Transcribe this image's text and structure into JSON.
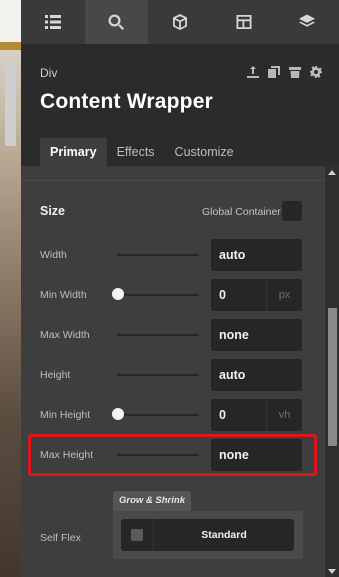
{
  "colors": {
    "highlight": "#e0141c",
    "panel_bg": "#343434",
    "header_bg": "#2b2b2b",
    "content_bg": "#3e3e3e",
    "input_bg": "#262626"
  },
  "icon_tabs": [
    {
      "icon": "list-icon",
      "active": false
    },
    {
      "icon": "search-icon",
      "active": true
    },
    {
      "icon": "cube-icon",
      "active": false
    },
    {
      "icon": "layout-icon",
      "active": false
    },
    {
      "icon": "layers-icon",
      "active": false
    }
  ],
  "header": {
    "element_type": "Div",
    "title": "Content Wrapper",
    "action_icons": [
      "move-up-icon",
      "duplicate-icon",
      "delete-icon",
      "settings-icon"
    ]
  },
  "sub_tabs": [
    {
      "label": "Primary",
      "active": true
    },
    {
      "label": "Effects",
      "active": false
    },
    {
      "label": "Customize",
      "active": false
    }
  ],
  "size_section": {
    "title": "Size",
    "global_container_label": "Global Container",
    "global_container_checked": false,
    "rows": [
      {
        "label": "Width",
        "value": "auto",
        "unit": "",
        "knob": false
      },
      {
        "label": "Min Width",
        "value": "0",
        "unit": "px",
        "knob": true
      },
      {
        "label": "Max Width",
        "value": "none",
        "unit": "",
        "knob": false
      },
      {
        "label": "Height",
        "value": "auto",
        "unit": "",
        "knob": false
      },
      {
        "label": "Min Height",
        "value": "0",
        "unit": "vh",
        "knob": true
      },
      {
        "label": "Max Height",
        "value": "none",
        "unit": "",
        "knob": false,
        "highlighted": true
      }
    ]
  },
  "self_flex": {
    "label": "Self Flex",
    "tab_label": "Grow & Shrink",
    "value": "Standard",
    "checked": false
  }
}
